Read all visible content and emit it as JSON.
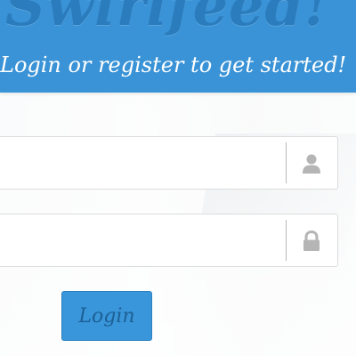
{
  "header": {
    "brand": "Swirlfeed!",
    "tagline": "Login or register to get started!"
  },
  "form": {
    "username": {
      "value": "",
      "placeholder": "",
      "icon": "user-icon"
    },
    "password": {
      "value": "",
      "placeholder": "",
      "icon": "lock-icon"
    },
    "login_label": "Login"
  },
  "colors": {
    "banner": "#3a93d6",
    "button": "#3996da",
    "button_text": "#1d5f95",
    "icon": "#b5b5b5"
  }
}
